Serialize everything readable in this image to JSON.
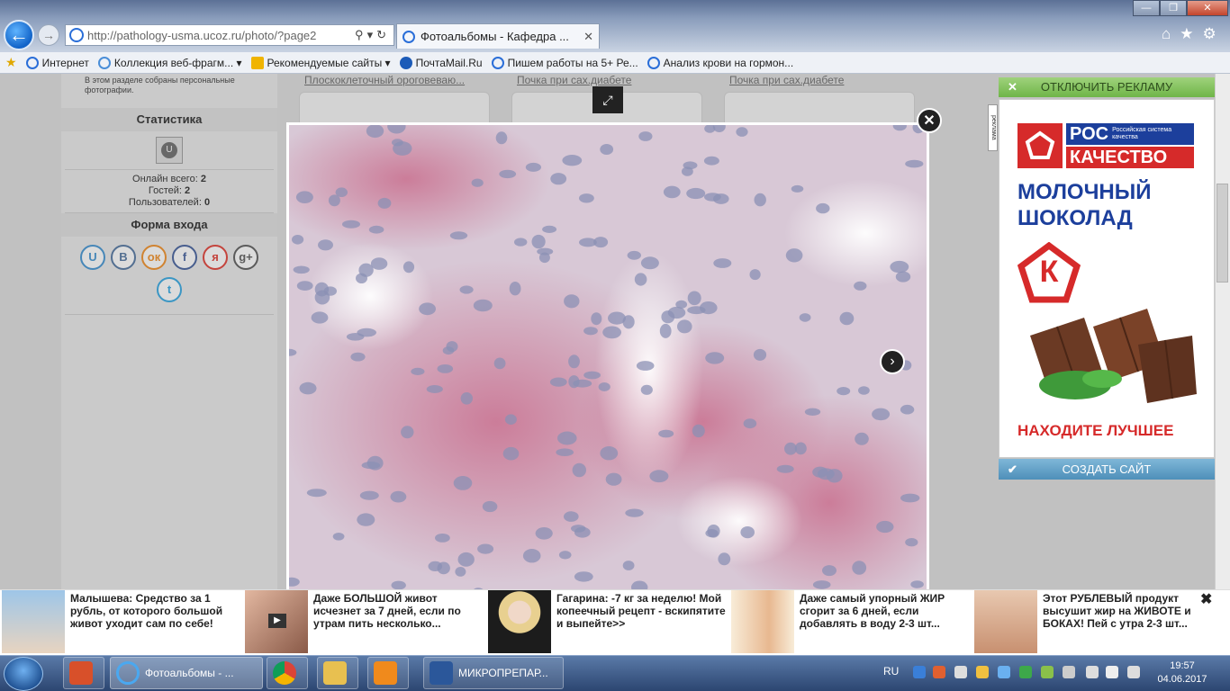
{
  "browser": {
    "address_url": "http://pathology-usma.ucoz.ru/photo/?page2",
    "tab_title": "Фотоальбомы - Кафедра ...",
    "favorites": [
      {
        "label": "Интернет",
        "color": "#2a6ed8"
      },
      {
        "label": "Коллекция веб-фрагм...",
        "color": "#4a8ed8"
      },
      {
        "label": "Рекомендуемые сайты",
        "color": "#f0b400"
      },
      {
        "label": "ПочтаMail.Ru",
        "color": "#1c5bb8"
      },
      {
        "label": "Пишем работы на 5+  Ре...",
        "color": "#2a6ed8"
      },
      {
        "label": "Анализ крови на гормон...",
        "color": "#2a6ed8"
      }
    ]
  },
  "site": {
    "section_note": "В этом разделе собраны персональные фотографии.",
    "stats": {
      "title": "Статистика",
      "online_label": "Онлайн всего:",
      "online_value": "2",
      "guests_label": "Гостей:",
      "guests_value": "2",
      "users_label": "Пользователей:",
      "users_value": "0"
    },
    "login": {
      "title": "Форма входа",
      "socials": [
        {
          "glyph": "U",
          "color": "#3a8fd0"
        },
        {
          "glyph": "B",
          "color": "#4a6f9c"
        },
        {
          "glyph": "ок",
          "color": "#f08a1c"
        },
        {
          "glyph": "f",
          "color": "#3b5998"
        },
        {
          "glyph": "я",
          "color": "#e0362c"
        },
        {
          "glyph": "g+",
          "color": "#555555"
        },
        {
          "glyph": "t",
          "color": "#2aa3e0"
        }
      ]
    },
    "thumb_captions": [
      "Плоскоклеточный ороговеваю...",
      "Почка при сах.диабете",
      "Почка при сах.диабете"
    ]
  },
  "ad": {
    "disable_label": "ОТКЛЮЧИТЬ РЕКЛАМУ",
    "create_label": "СОЗДАТЬ САЙТ",
    "brand_top": "РОС",
    "brand_small": "Российская система качества",
    "brand_bottom": "КАЧЕСТВО",
    "product": "МОЛОЧНЫЙ ШОКОЛАД",
    "slogan": "НАХОДИТЕ ЛУЧШЕЕ",
    "k_glyph": "К",
    "mark": "реклама"
  },
  "news": [
    {
      "text": "Малышева: Средство за 1 рубль, от которого большой живот уходит сам по себе!"
    },
    {
      "text": "Даже БОЛЬШОЙ живот исчезнет за 7 дней, если по утрам пить несколько..."
    },
    {
      "text": "Гагарина: -7 кг за неделю! Мой копеечный рецепт - вскипятите и выпейте>>"
    },
    {
      "text": "Даже самый упорный ЖИР сгорит за 6 дней, если добавлять в воду 2-3 шт..."
    },
    {
      "text": "Этот РУБЛЕВЫЙ продукт высушит жир на ЖИВОТЕ и БОКАХ! Пей с утра 2-3 шт..."
    }
  ],
  "taskbar": {
    "btn1": "Фотоальбомы - ...",
    "btn2": "МИКРОПРЕПАР...",
    "lang": "RU",
    "time": "19:57",
    "date": "04.06.2017"
  }
}
